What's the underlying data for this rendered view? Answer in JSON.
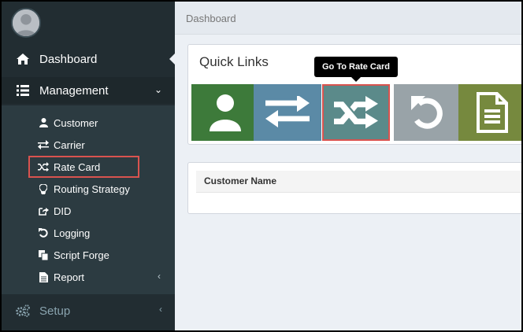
{
  "sidebar": {
    "dashboard_label": "Dashboard",
    "management_label": "Management",
    "management_items": [
      {
        "label": "Customer",
        "icon": "user-icon"
      },
      {
        "label": "Carrier",
        "icon": "exchange-icon"
      },
      {
        "label": "Rate Card",
        "icon": "random-icon"
      },
      {
        "label": "Routing Strategy",
        "icon": "lightbulb-icon"
      },
      {
        "label": "DID",
        "icon": "share-square-icon"
      },
      {
        "label": "Logging",
        "icon": "undo-icon"
      },
      {
        "label": "Script Forge",
        "icon": "copy-icon"
      },
      {
        "label": "Report",
        "icon": "file-icon"
      }
    ],
    "setup_label": "Setup"
  },
  "breadcrumb": "Dashboard",
  "quick_links": {
    "title": "Quick Links",
    "tooltip": "Go To Rate Card",
    "tiles": [
      {
        "icon": "user-icon",
        "color": "#3d7a3a"
      },
      {
        "icon": "exchange-icon",
        "color": "#5b8aa6"
      },
      {
        "icon": "random-icon",
        "color": "#5b8a8a"
      },
      {
        "icon": "undo-icon",
        "color": "#99a3a8"
      },
      {
        "icon": "file-text-icon",
        "color": "#76893e"
      }
    ]
  },
  "table": {
    "columns": [
      "Customer Name"
    ]
  },
  "colors": {
    "sidebar_bg": "#222d32",
    "submenu_bg": "#2c3b41",
    "highlight_red": "#d9534f",
    "content_bg": "#ecf0f5"
  }
}
